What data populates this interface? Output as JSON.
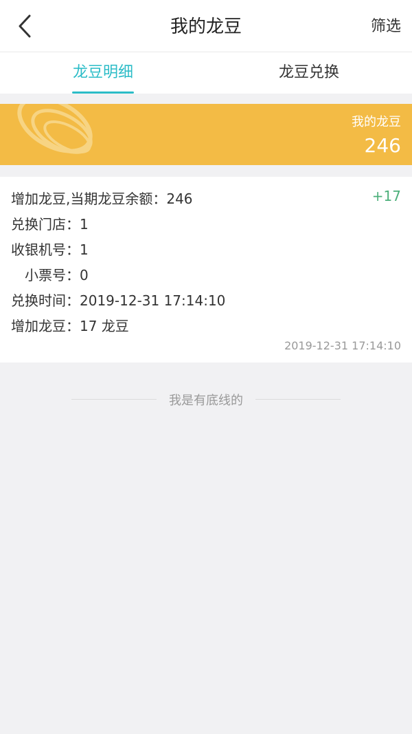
{
  "navbar": {
    "title": "我的龙豆",
    "filter_label": "筛选"
  },
  "tabs": [
    {
      "label": "龙豆明细",
      "active": true
    },
    {
      "label": "龙豆兑换",
      "active": false
    }
  ],
  "banner": {
    "label": "我的龙豆",
    "value": "246"
  },
  "record": {
    "summary": "增加龙豆,当期龙豆余额：246",
    "amount": "+17",
    "store": "兑换门店：1",
    "cashier": "收银机号：1",
    "receipt": "小票号：0",
    "exchange_time": "兑换时间：2019-12-31 17:14:10",
    "added": "增加龙豆：17 龙豆",
    "timestamp": "2019-12-31 17:14:10"
  },
  "footer": {
    "text": "我是有底线的"
  },
  "colors": {
    "accent": "#2bbcc7",
    "banner": "#f3bb45",
    "positive": "#4caf7a"
  }
}
